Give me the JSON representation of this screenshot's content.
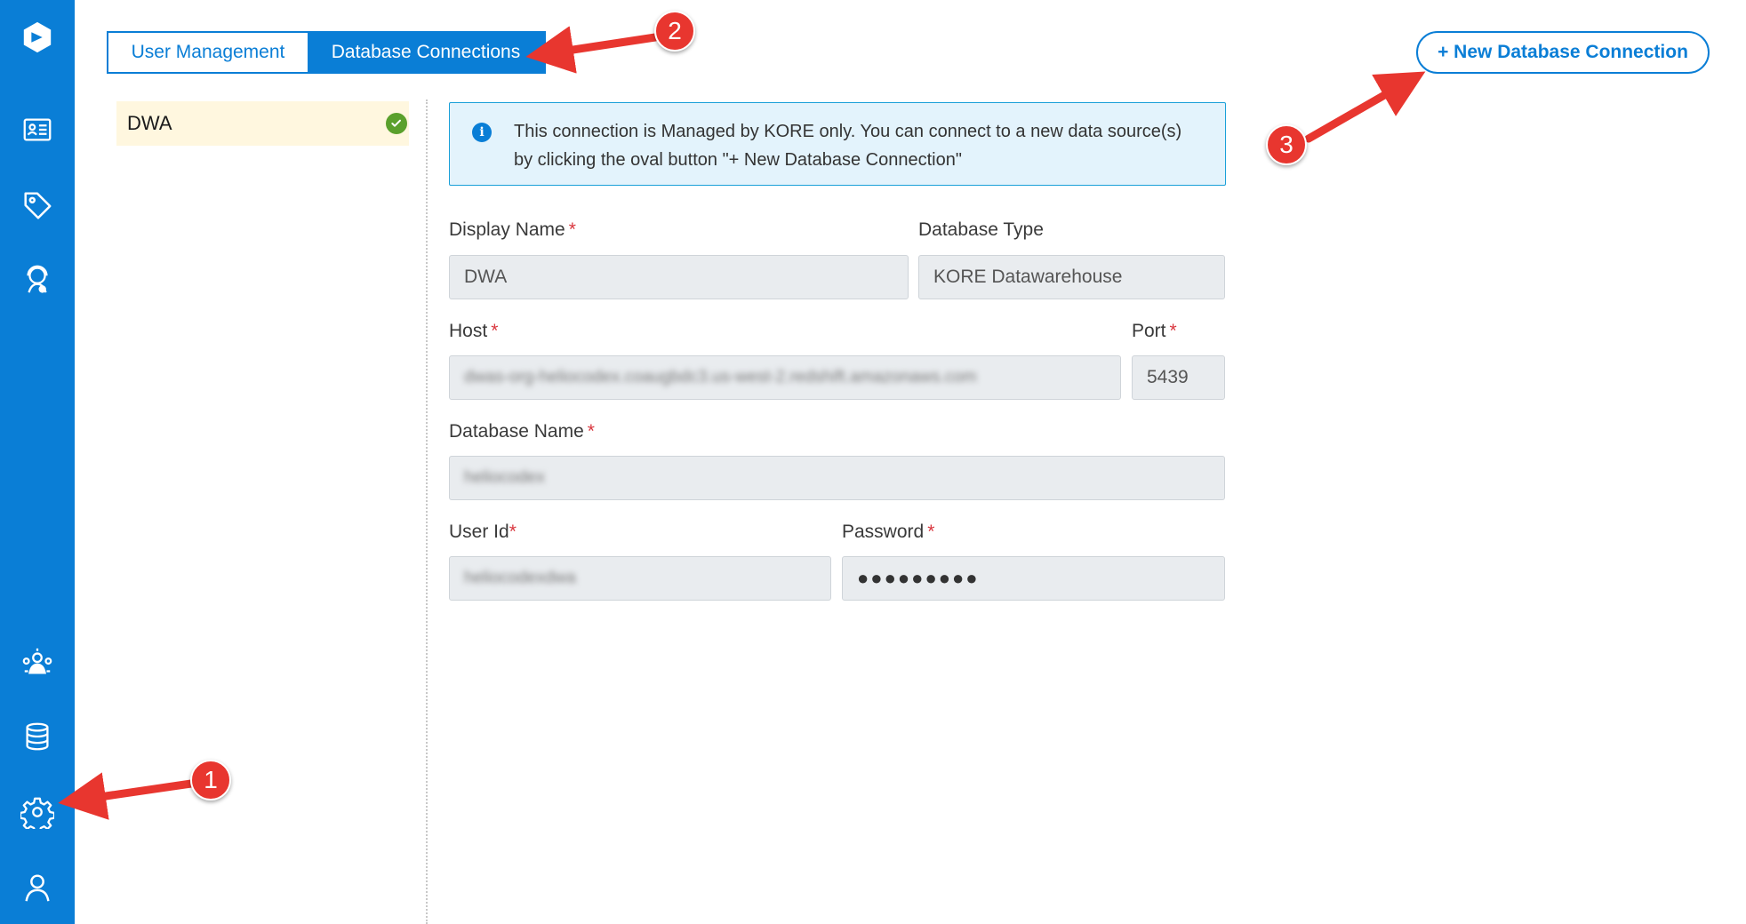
{
  "sidebar": {
    "items": [
      {
        "icon": "logo-icon"
      },
      {
        "icon": "contact-card-icon"
      },
      {
        "icon": "tag-icon"
      },
      {
        "icon": "support-agent-icon"
      },
      {
        "icon": "team-settings-icon"
      },
      {
        "icon": "database-icon"
      },
      {
        "icon": "gear-icon"
      },
      {
        "icon": "user-icon"
      }
    ]
  },
  "tabs": [
    {
      "label": "User Management",
      "active": false
    },
    {
      "label": "Database Connections",
      "active": true
    }
  ],
  "new_connection_label": "+ New Database Connection",
  "connections": [
    {
      "name": "DWA",
      "status": "connected"
    }
  ],
  "info": {
    "icon_text": "i",
    "text": "This connection is Managed by KORE only. You can connect to a new data source(s) by clicking the oval button \"+ New Database Connection\""
  },
  "form": {
    "display_name": {
      "label": "Display Name",
      "required": "*",
      "value": "DWA"
    },
    "database_type": {
      "label": "Database Type",
      "value": "KORE Datawarehouse"
    },
    "host": {
      "label": "Host",
      "required": "*",
      "value": "dwas-org-heliocodex.coaugbdc3.us-west-2.redshift.amazonaws.com"
    },
    "port": {
      "label": "Port",
      "required": "*",
      "value": "5439"
    },
    "database_name": {
      "label": "Database Name",
      "required": "*",
      "value": "heliocodex"
    },
    "user_id": {
      "label": "User Id",
      "required": "*",
      "value": "heliocodexdwa"
    },
    "password": {
      "label": "Password",
      "required": "*",
      "value": "●●●●●●●●●"
    }
  },
  "annotations": {
    "badge1": "1",
    "badge2": "2",
    "badge3": "3",
    "color": "#e8362f"
  },
  "colors": {
    "primary": "#0a7ed6",
    "selected_item_bg": "#fff7df",
    "success": "#5aa02c",
    "required": "#d9363e",
    "info_bg": "#e3f3fc"
  }
}
